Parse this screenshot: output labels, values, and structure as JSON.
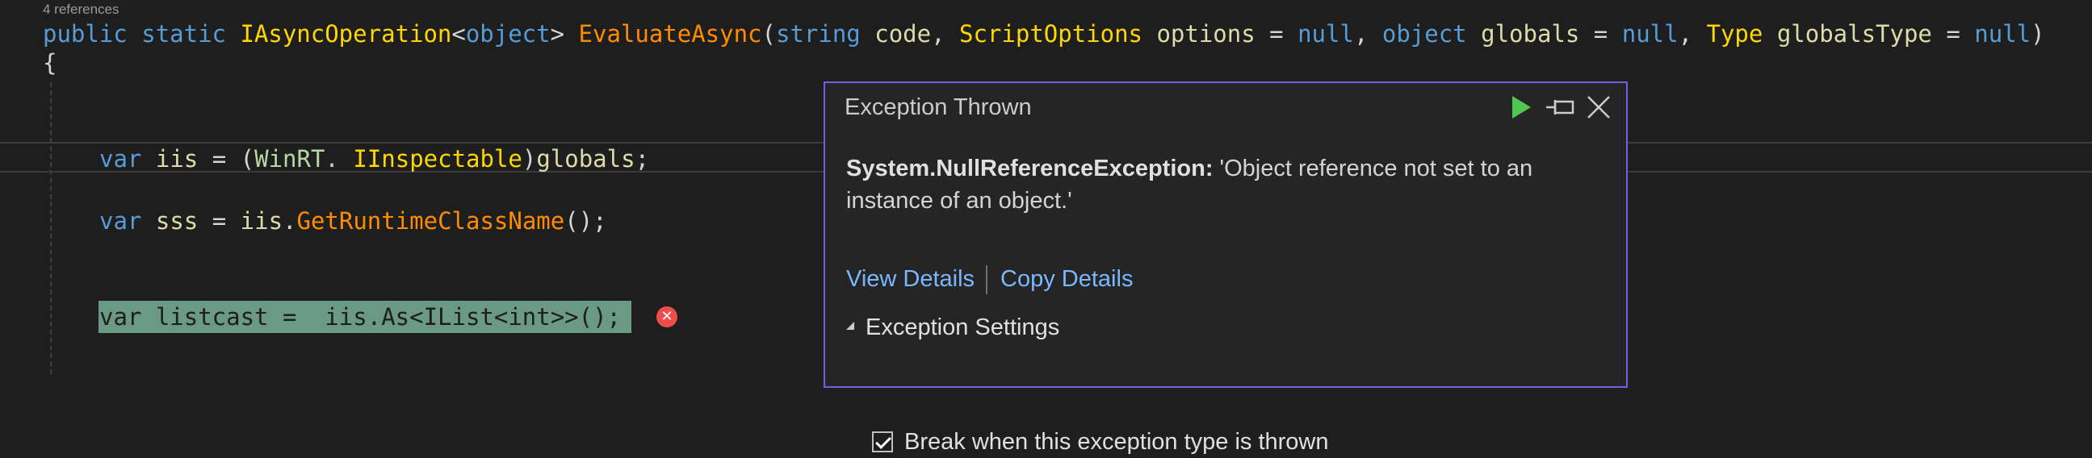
{
  "editor": {
    "codelens": "4 references",
    "signature": {
      "kw_public": "public",
      "kw_static": "static",
      "return_type": "IAsyncOperation",
      "lt": "<",
      "kw_object": "object",
      "gt": ">",
      "method": "EvaluateAsync",
      "open_paren": "(",
      "kw_string": "string",
      "p_code": "code",
      "comma1": ",",
      "type_scriptoptions": "ScriptOptions",
      "p_options": "options",
      "eq1": "=",
      "null1": "null",
      "comma2": ",",
      "kw_object2": "object",
      "p_globals": "globals",
      "eq2": "=",
      "null2": "null",
      "comma3": ",",
      "type_type": "Type",
      "p_globalstype": "globalsType",
      "eq3": "=",
      "null3": "null",
      "close_paren": ")"
    },
    "brace": "{",
    "line_iis": {
      "kw_var": "var",
      "name": "iis",
      "eq": "=",
      "cast_open": "(",
      "ns": "WinRT.",
      "iface": "IInspectable",
      "cast_close": ")",
      "arg": "globals",
      "semi": ";"
    },
    "line_sss": {
      "kw_var": "var",
      "name": "sss",
      "eq": "=",
      "obj": "iis.",
      "method": "GetRuntimeClassName",
      "rest": "();"
    },
    "line_listcast": "var listcast =  iis.As<IList<int>>();",
    "error_glyph": "✕"
  },
  "exception_popup": {
    "title": "Exception Thrown",
    "exception_type": "System.NullReferenceException:",
    "message": "'Object reference not set to an instance of an object.'",
    "view_details": "View Details",
    "copy_details": "Copy Details",
    "settings_header": "Exception Settings",
    "break_checkbox_label": "Break when this exception type is thrown",
    "break_checked": true,
    "accent_color": "#7160e8",
    "continue_color": "#4ec94e"
  }
}
